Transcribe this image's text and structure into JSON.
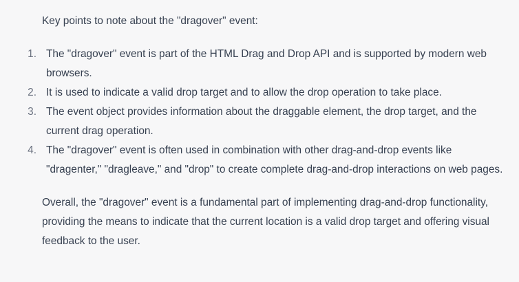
{
  "intro": "Key points to note about the \"dragover\" event:",
  "points": [
    {
      "number": "1.",
      "text": "The \"dragover\" event is part of the HTML Drag and Drop API and is supported by modern web browsers."
    },
    {
      "number": "2.",
      "text": "It is used to indicate a valid drop target and to allow the drop operation to take place."
    },
    {
      "number": "3.",
      "text": "The event object provides information about the draggable element, the drop target, and the current drag operation."
    },
    {
      "number": "4.",
      "text": "The \"dragover\" event is often used in combination with other drag-and-drop events like \"dragenter,\" \"dragleave,\" and \"drop\" to create complete drag-and-drop interactions on web pages."
    }
  ],
  "outro": "Overall, the \"dragover\" event is a fundamental part of implementing drag-and-drop functionality, providing the means to indicate that the current location is a valid drop target and offering visual feedback to the user.",
  "colors": {
    "background": "#f7f7f8",
    "text": "#374151",
    "list_number": "#6b7280"
  }
}
